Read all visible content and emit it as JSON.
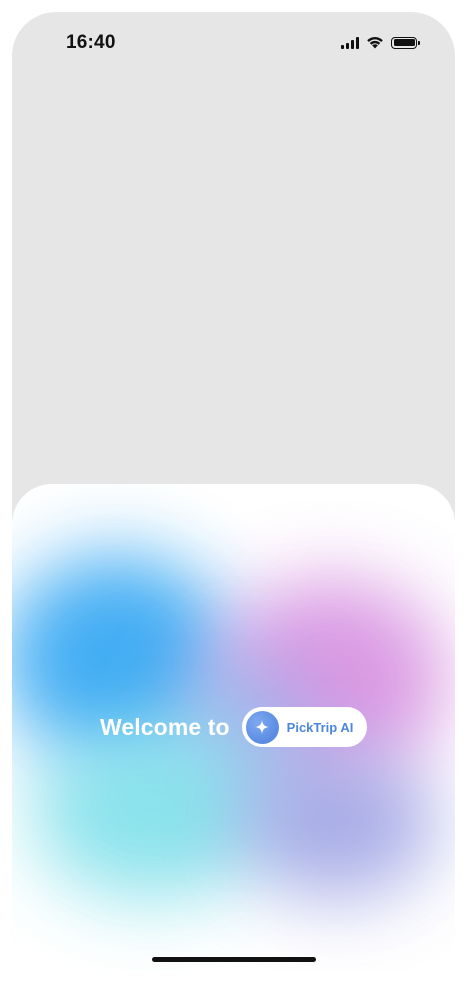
{
  "status_bar": {
    "time": "16:40"
  },
  "welcome": {
    "text": "Welcome to",
    "brand_name": "PickTrip AI"
  },
  "icons": {
    "signal": "cellular-signal-icon",
    "wifi": "wifi-icon",
    "battery": "battery-icon",
    "logo": "sparkle-icon"
  },
  "colors": {
    "top_background": "#e6e6e6",
    "brand_text": "#4d86dc",
    "brand_logo": "#5b8fe3",
    "blob_blue": "#39a9f3",
    "blob_pink": "#d68ee0",
    "blob_cyan": "#7fe0ea",
    "blob_violet": "#9aa0e3"
  }
}
